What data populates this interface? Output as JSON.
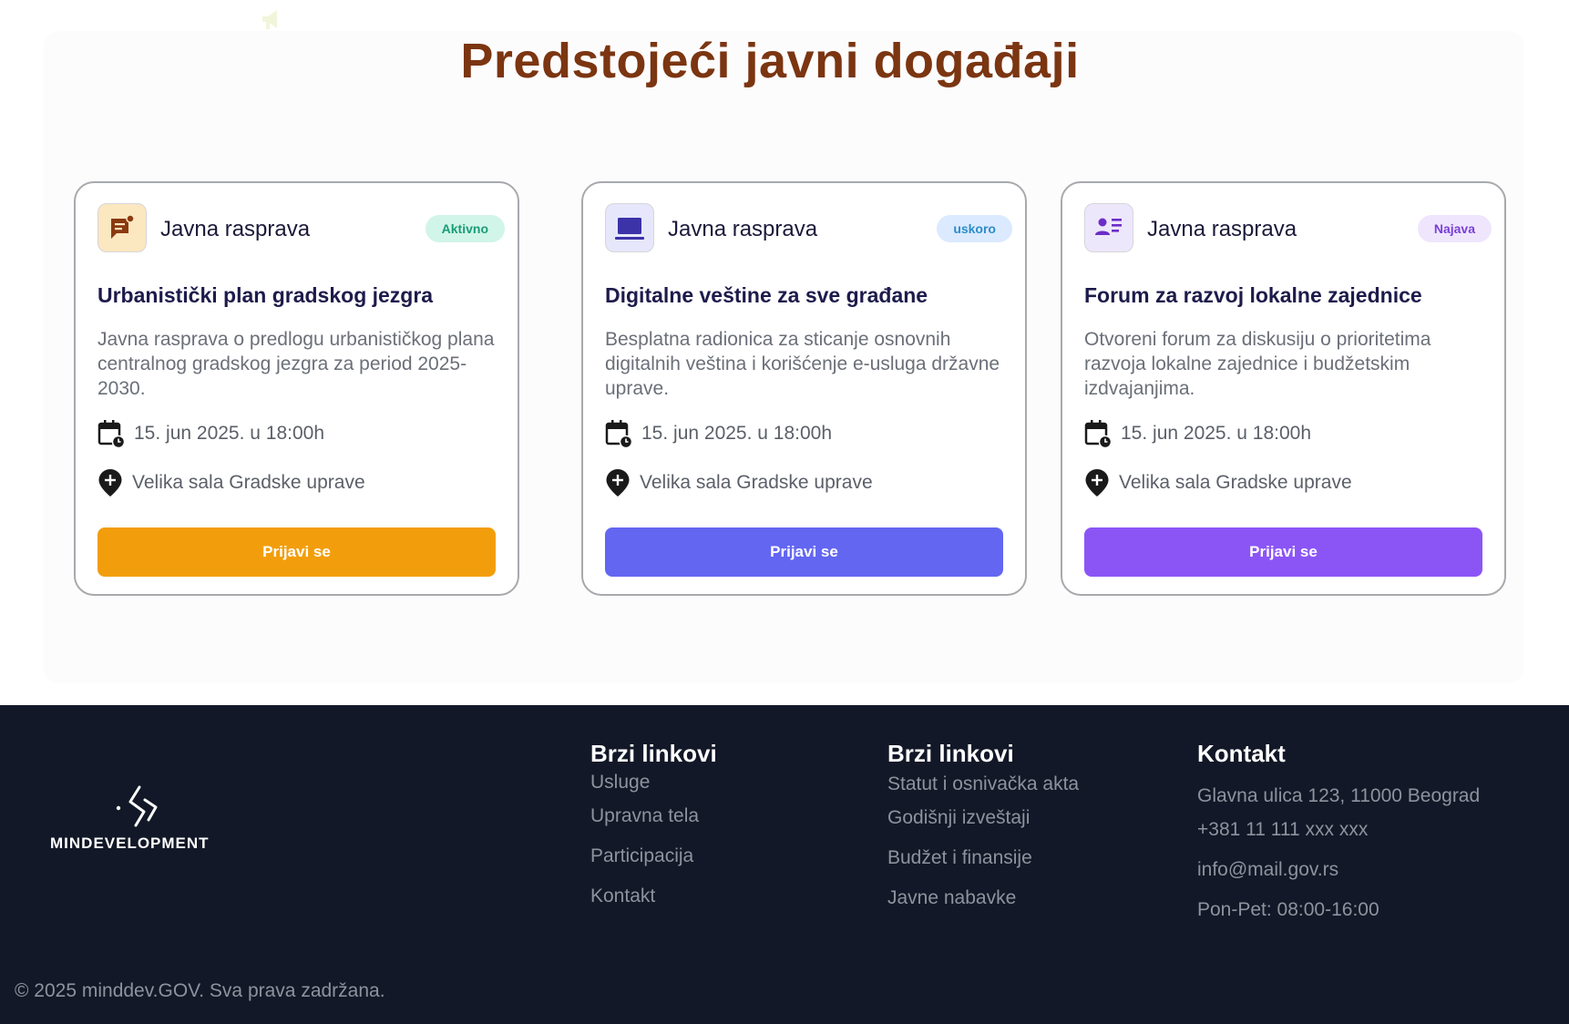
{
  "section": {
    "title": "Predstojeći javni događaji"
  },
  "cards": [
    {
      "type": "Javna rasprava",
      "icon": "comment-icon",
      "badge": "Aktivno",
      "badge_bg": "#d1f5e8",
      "badge_color": "#1a9c77",
      "icon_bg": "#fbe7c0",
      "icon_color": "#8a3a0f",
      "title": "Urbanistički plan gradskog jezgra",
      "description": "Javna rasprava o predlogu urbanističkog plana centralnog gradskog jezgra za period 2025-2030.",
      "date": "15. jun 2025. u 18:00h",
      "location": "Velika sala Gradske uprave",
      "button": "Prijavi se",
      "button_color": "#f29e0c"
    },
    {
      "type": "Javna rasprava",
      "icon": "laptop-icon",
      "badge": "uskoro",
      "badge_bg": "#dbeafe",
      "badge_color": "#2d8cc9",
      "icon_bg": "#e6e7fb",
      "icon_color": "#3c33a8",
      "title": "Digitalne veštine za sve građane",
      "description": "Besplatna radionica za sticanje osnovnih digitalnih veština i korišćenje e-usluga državne uprave.",
      "date": "15. jun 2025. u 18:00h",
      "location": "Velika sala Gradske uprave",
      "button": "Prijavi se",
      "button_color": "#6366f1"
    },
    {
      "type": "Javna rasprava",
      "icon": "user-list-icon",
      "badge": "Najava",
      "badge_bg": "#efe6fd",
      "badge_color": "#7a3fd6",
      "icon_bg": "#ede7fb",
      "icon_color": "#6c2dc7",
      "title": "Forum za razvoj lokalne zajednice",
      "description": "Otvoreni forum za diskusiju o prioritetima razvoja lokalne zajednice i budžetskim izdvajanjima.",
      "date": "15. jun 2025. u 18:00h",
      "location": "Velika sala Gradske uprave",
      "button": "Prijavi se",
      "button_color": "#8b55f6"
    }
  ],
  "footer": {
    "logo_text": "MINDEVELOPMENT",
    "col1": {
      "title": "Brzi linkovi",
      "links": [
        "Usluge",
        "Upravna tela",
        "Participacija",
        "Kontakt"
      ]
    },
    "col2": {
      "title": "Brzi linkovi",
      "links": [
        "Statut i osnivačka akta",
        "Godišnji izveštaji",
        "Budžet i finansije",
        "Javne nabavke"
      ]
    },
    "col3": {
      "title": "Kontakt",
      "lines": [
        "Glavna ulica 123, 11000 Beograd",
        "+381 11 111 xxx xxx",
        "info@mail.gov.rs",
        "Pon-Pet: 08:00-16:00"
      ]
    },
    "copyright": "© 2025 minddev.GOV. Sva prava zadržana."
  }
}
